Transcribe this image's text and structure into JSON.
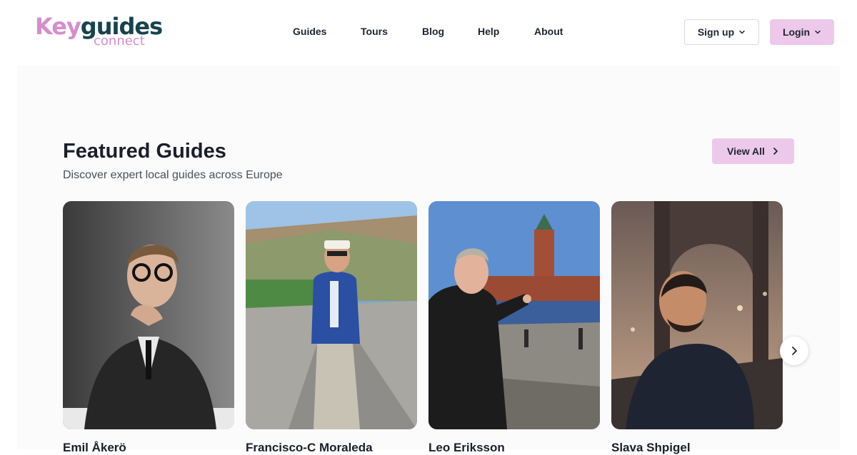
{
  "logo": {
    "top_part_1": "Key",
    "top_part_2": "guides",
    "bottom": "connect"
  },
  "nav": [
    {
      "label": "Guides"
    },
    {
      "label": "Tours"
    },
    {
      "label": "Blog"
    },
    {
      "label": "Help"
    },
    {
      "label": "About"
    }
  ],
  "auth": {
    "signup_label": "Sign up",
    "login_label": "Login"
  },
  "featured": {
    "title": "Featured Guides",
    "subtitle": "Discover expert local guides across Europe",
    "view_all_label": "View All",
    "guides": [
      {
        "name": "Emil Åkerö"
      },
      {
        "name": "Francisco-C Moraleda"
      },
      {
        "name": "Leo Eriksson"
      },
      {
        "name": "Slava Shpigel"
      }
    ]
  },
  "colors": {
    "accent_pink": "#ecc9ea",
    "logo_pink": "#d58ecb",
    "logo_teal": "#17434d",
    "section_bg": "#fbfbfb"
  },
  "icons": {
    "signup_chevron": "chevron-down-icon",
    "login_chevron": "chevron-down-icon",
    "view_all_arrow": "chevron-right-icon",
    "carousel_next": "chevron-right-icon"
  }
}
